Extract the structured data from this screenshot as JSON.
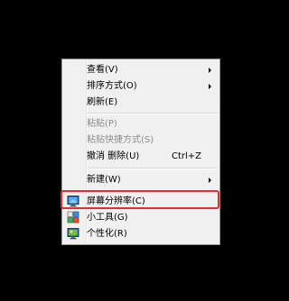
{
  "context_menu": {
    "items": [
      {
        "label": "查看(V)",
        "has_submenu": true,
        "enabled": true
      },
      {
        "label": "排序方式(O)",
        "has_submenu": true,
        "enabled": true
      },
      {
        "label": "刷新(E)",
        "enabled": true
      },
      {
        "label": "粘贴(P)",
        "enabled": false
      },
      {
        "label": "粘贴快捷方式(S)",
        "enabled": false
      },
      {
        "label": "撤消 删除(U)",
        "shortcut": "Ctrl+Z",
        "enabled": true
      },
      {
        "label": "新建(W)",
        "has_submenu": true,
        "enabled": true
      },
      {
        "label": "屏幕分辨率(C)",
        "icon": "screen-resolution-icon",
        "enabled": true,
        "highlighted": true
      },
      {
        "label": "小工具(G)",
        "icon": "gadgets-icon",
        "enabled": true
      },
      {
        "label": "个性化(R)",
        "icon": "personalize-icon",
        "enabled": true
      }
    ]
  },
  "colors": {
    "highlight_outline": "#e0302e",
    "menu_background": "#f0f0f0",
    "disabled_text": "#8d8d8d"
  }
}
